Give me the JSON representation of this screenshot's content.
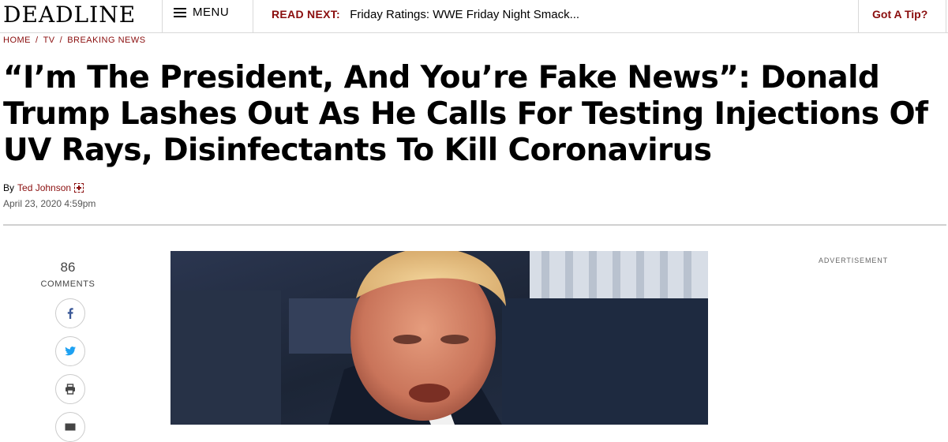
{
  "header": {
    "logo": "DEADLINE",
    "menu_label": "MENU",
    "read_next_label": "READ NEXT:",
    "read_next_title": "Friday Ratings: WWE Friday Night Smack...",
    "tip_label": "Got A Tip?"
  },
  "breadcrumb": [
    "HOME",
    "TV",
    "BREAKING NEWS"
  ],
  "article": {
    "headline": "“I’m The President, And You’re Fake News”: Donald Trump Lashes Out As He Calls For Testing Injections Of UV Rays, Disinfectants To Kill Coronavirus",
    "by_prefix": "By",
    "author": "Ted Johnson",
    "date": "April 23, 2020 4:59pm"
  },
  "social": {
    "comments_count": "86",
    "comments_label": "COMMENTS",
    "icons": [
      "facebook-icon",
      "twitter-icon",
      "print-icon",
      "email-icon"
    ]
  },
  "sidebar": {
    "ad_label": "ADVERTISEMENT"
  },
  "colors": {
    "accent": "#8a0d0d",
    "text": "#000000",
    "muted": "#555555"
  }
}
